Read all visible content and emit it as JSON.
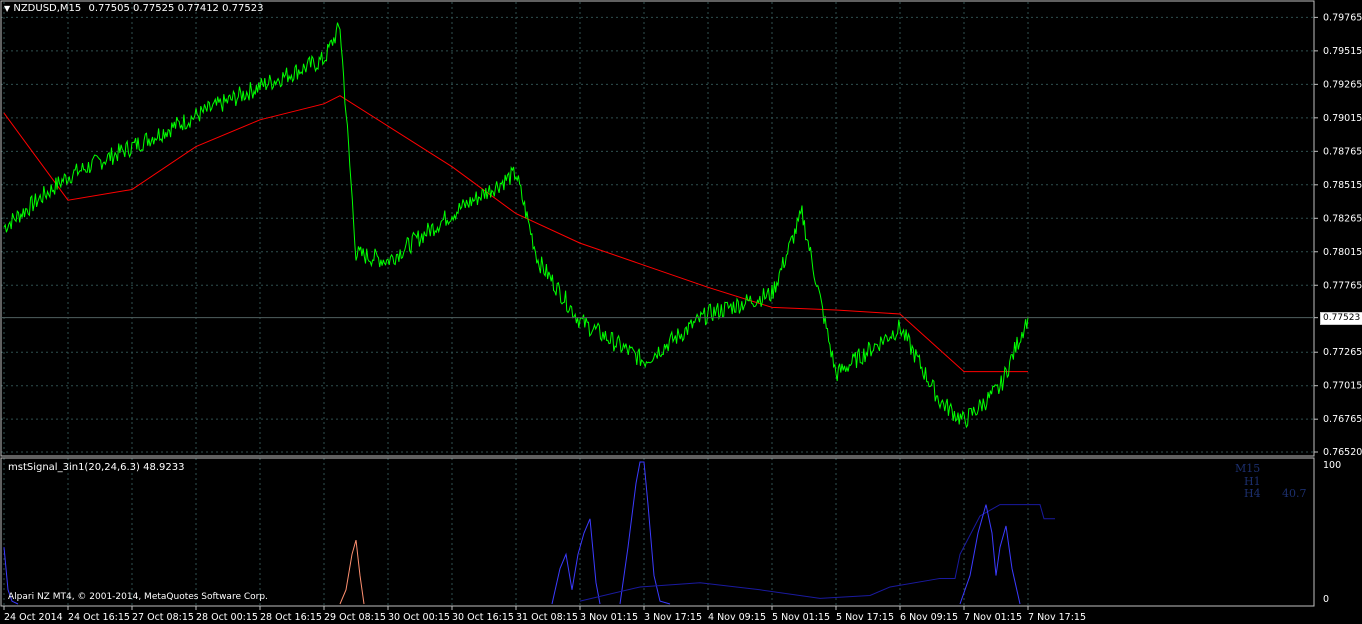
{
  "header": {
    "symbol": "NZDUSD,M15",
    "open": "0.77505",
    "high": "0.77525",
    "low": "0.77412",
    "close": "0.77523"
  },
  "indicator": {
    "name": "mstSignal_3in1(20,24,6.3)",
    "value": "48.9233",
    "labels": [
      "M15",
      "H1",
      "H4"
    ],
    "h4_value": "40.7",
    "scale_top": "100",
    "scale_bottom": "0"
  },
  "watermark": "Alpari NZ MT4, © 2001-2014, MetaQuotes Software Corp.",
  "price_axis": [
    "0.79765",
    "0.79515",
    "0.79265",
    "0.79015",
    "0.78765",
    "0.78515",
    "0.78265",
    "0.78015",
    "0.77765",
    "0.77523",
    "0.77265",
    "0.77015",
    "0.76765",
    "0.76520"
  ],
  "time_axis": [
    "24 Oct 2014",
    "24 Oct 16:15",
    "27 Oct 08:15",
    "28 Oct 00:15",
    "28 Oct 16:15",
    "29 Oct 08:15",
    "30 Oct 00:15",
    "30 Oct 16:15",
    "31 Oct 08:15",
    "3 Nov 01:15",
    "3 Nov 17:15",
    "4 Nov 09:15",
    "5 Nov 01:15",
    "5 Nov 17:15",
    "6 Nov 09:15",
    "7 Nov 01:15",
    "7 Nov 17:15"
  ],
  "current_price": "0.77523",
  "colors": {
    "background": "#000000",
    "price_line": "#00ff00",
    "ma_line": "#ff0000",
    "grid": "#2f4f4f",
    "indicator_blue": "#3b3bff",
    "indicator_navy": "#1a1aa0",
    "indicator_salmon": "#ff9070"
  },
  "chart_data": {
    "type": "line",
    "series": [
      {
        "values_x_time": [
          "24 Oct 2014",
          "24 Oct 16:15",
          "27 Oct 08:15",
          "28 Oct 00:15",
          "28 Oct 16:15",
          "29 Oct 08:15",
          "29 Oct 12:00",
          "29 Oct 20:00",
          "30 Oct 00:15",
          "30 Oct 16:15",
          "31 Oct 08:15",
          "31 Oct 12:00",
          "3 Nov 01:15",
          "3 Nov 17:15",
          "4 Nov 09:15",
          "5 Nov 01:15",
          "5 Nov 09:00",
          "5 Nov 17:15",
          "6 Nov 09:15",
          "6 Nov 20:00",
          "7 Nov 01:15",
          "7 Nov 09:00",
          "7 Nov 17:15"
        ],
        "values": [
          0.782,
          0.7858,
          0.788,
          0.7903,
          0.7925,
          0.7945,
          0.797,
          0.78,
          0.7795,
          0.783,
          0.786,
          0.7795,
          0.775,
          0.772,
          0.7755,
          0.777,
          0.783,
          0.771,
          0.7745,
          0.769,
          0.7675,
          0.77,
          0.7753
        ]
      },
      {
        "values_x_time": [
          "24 Oct 2014",
          "24 Oct 16:15",
          "27 Oct 08:15",
          "28 Oct 00:15",
          "28 Oct 16:15",
          "29 Oct 08:15",
          "29 Oct 12:00",
          "30 Oct 16:15",
          "31 Oct 08:15",
          "3 Nov 01:15",
          "4 Nov 09:15",
          "5 Nov 01:15",
          "5 Nov 17:15",
          "6 Nov 09:15",
          "7 Nov 01:15",
          "7 Nov 17:15"
        ],
        "values": [
          0.7905,
          0.784,
          0.7848,
          0.788,
          0.79,
          0.7912,
          0.7918,
          0.7865,
          0.783,
          0.7808,
          0.7775,
          0.776,
          0.7758,
          0.7755,
          0.7712,
          0.7712
        ]
      }
    ],
    "ylim": [
      0.7652,
      0.7985
    ]
  }
}
